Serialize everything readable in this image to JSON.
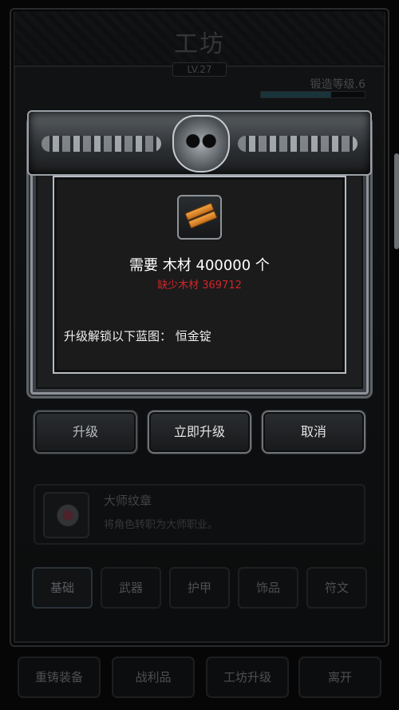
{
  "workshop": {
    "title": "工坊",
    "level": "LV.27",
    "forge_level_label": "锻造等级.6",
    "forge_progress": 0.68,
    "cards": [
      {
        "title": "大师纹章",
        "desc": "将角色转职为大师职业。"
      }
    ],
    "category_tabs": [
      "基础",
      "武器",
      "护甲",
      "饰品",
      "符文"
    ],
    "active_tab": "基础",
    "bottom_buttons": [
      "重铸装备",
      "战利品",
      "工坊升级",
      "离开"
    ]
  },
  "dialog": {
    "requirement": "需要 木材 400000 个",
    "shortage": "缺少木材 369712",
    "unlock": "升级解锁以下蓝图： 恒金锭",
    "buttons": {
      "upgrade": "升级",
      "instant_upgrade": "立即升级",
      "cancel": "取消"
    },
    "item_icon": "wood-planks-icon",
    "colors": {
      "shortage": "#d2252a",
      "text": "#ffffff"
    }
  }
}
